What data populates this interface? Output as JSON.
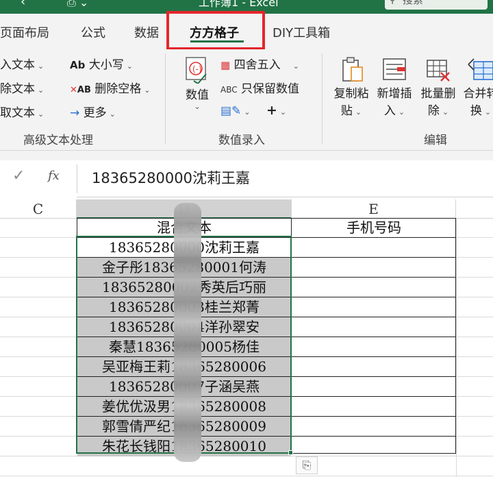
{
  "titlebar": {
    "doc_title": "工作簿1 - Excel",
    "search_placeholder": "搜索"
  },
  "tabs": [
    {
      "label": "页面布局"
    },
    {
      "label": "公式"
    },
    {
      "label": "数据"
    },
    {
      "label": "方方格子",
      "active": true
    },
    {
      "label": "DIY工具箱"
    }
  ],
  "ribbon": {
    "text_group": {
      "items": [
        "入文本",
        "除文本",
        "取文本"
      ],
      "case_label": "大小写",
      "delete_space_label": "删除空格",
      "more_label": "更多",
      "group_label": "高级文本处理"
    },
    "number_group": {
      "numeric_label": "数值",
      "round_label": "四舍五入",
      "keep_value_label": "只保留数值",
      "plus_label": "+",
      "group_label": "数值录入"
    },
    "edit_group": {
      "buttons": [
        {
          "label1": "复制粘",
          "label2": "贴"
        },
        {
          "label1": "新增插",
          "label2": "入"
        },
        {
          "label1": "批量删",
          "label2": "除"
        },
        {
          "label1": "合并转",
          "label2": "换"
        }
      ],
      "group_label": "编辑"
    }
  },
  "formula_bar": {
    "fx_label": "fx",
    "content": "18365280000沈莉王嘉"
  },
  "sheet": {
    "columns": [
      "C",
      "D",
      "E"
    ],
    "header_row": {
      "d": "混合文本",
      "e": "手机号码"
    },
    "rows": [
      "18365280000沈莉王嘉",
      "金子彤18365280001何涛",
      "18365280002秀英后巧丽",
      "18365280003桂兰郑菁",
      "18365280004洋孙翠安",
      "秦慧18365280005杨佳",
      "吴亚梅王莉18365280006",
      "18365280007子涵吴燕",
      "姜优优汲男18365280008",
      "郭雪倩严纪18365280009",
      "朱花长钱阳18365280010"
    ]
  }
}
